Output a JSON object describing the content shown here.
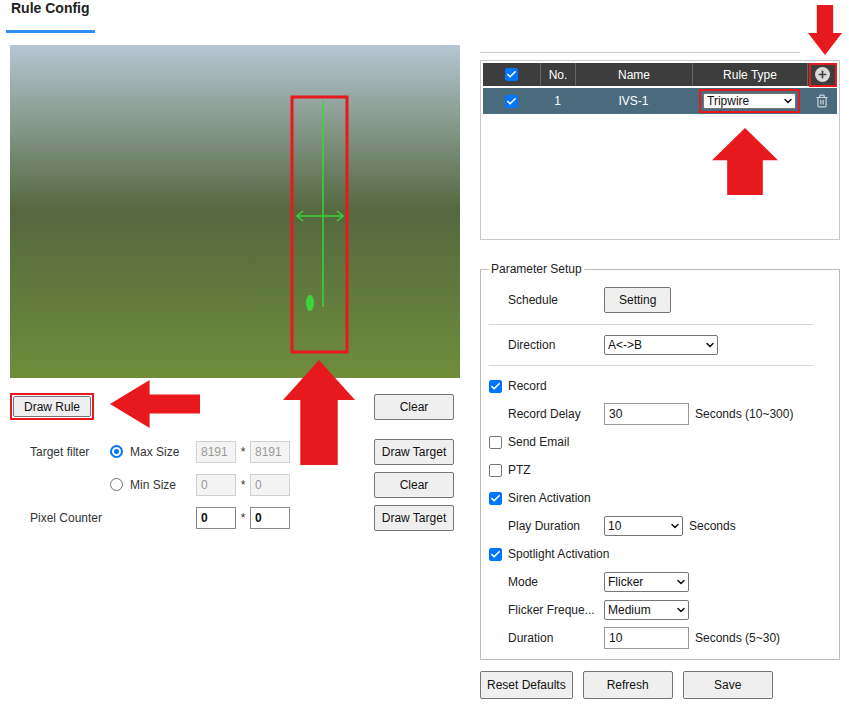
{
  "title": "Rule Config",
  "draw_rule_button": "Draw Rule",
  "clear_button": "Clear",
  "target_filter": {
    "label": "Target filter",
    "options": [
      {
        "label": "Max Size",
        "selected": true,
        "width": "8191",
        "height": "8191",
        "separator": "*",
        "button": "Draw Target",
        "disabled": true
      },
      {
        "label": "Min Size",
        "selected": false,
        "width": "0",
        "height": "0",
        "separator": "*",
        "button": "Clear",
        "disabled": true
      }
    ]
  },
  "pixel_counter": {
    "label": "Pixel Counter",
    "width": "0",
    "height": "0",
    "separator": "*",
    "button": "Draw Target",
    "disabled": false
  },
  "rules_table": {
    "header_checked": true,
    "columns": [
      "No.",
      "Name",
      "Rule Type"
    ],
    "rows": [
      {
        "checked": true,
        "selected": true,
        "no": "1",
        "name": "IVS-1",
        "rule_type": "Tripwire"
      }
    ]
  },
  "parameter_setup": {
    "legend": "Parameter Setup",
    "rows": [
      {
        "kind": "button",
        "label": "Schedule",
        "value": "Setting"
      },
      {
        "kind": "divider"
      },
      {
        "kind": "select",
        "label": "Direction",
        "value": "A<->B"
      },
      {
        "kind": "divider"
      },
      {
        "kind": "checkbox",
        "label": "Record",
        "checked": true
      },
      {
        "kind": "input",
        "label": "Record Delay",
        "value": "30",
        "unit": "Seconds (10~300)"
      },
      {
        "kind": "checkbox",
        "label": "Send Email",
        "checked": false
      },
      {
        "kind": "checkbox",
        "label": "PTZ",
        "checked": false
      },
      {
        "kind": "checkbox",
        "label": "Siren Activation",
        "checked": true
      },
      {
        "kind": "select",
        "label": "Play Duration",
        "value": "10",
        "unit": "Seconds"
      },
      {
        "kind": "checkbox",
        "label": "Spotlight Activation",
        "checked": true
      },
      {
        "kind": "select",
        "label": "Mode",
        "value": "Flicker"
      },
      {
        "kind": "select",
        "label": "Flicker Freque...",
        "value": "Medium"
      },
      {
        "kind": "input",
        "label": "Duration",
        "value": "10",
        "unit": "Seconds (5~30)"
      }
    ]
  },
  "footer_buttons": [
    "Reset Defaults",
    "Refresh",
    "Save"
  ]
}
